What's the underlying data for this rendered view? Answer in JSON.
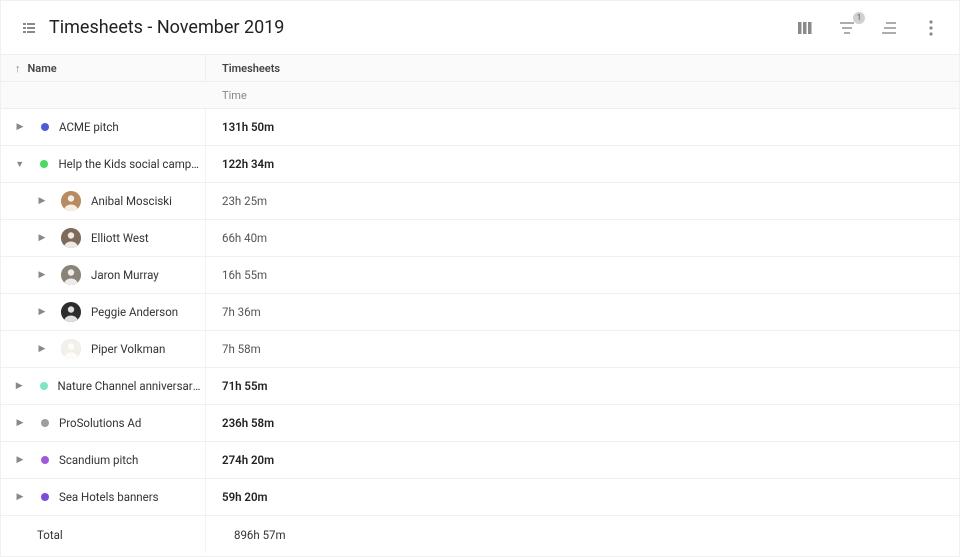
{
  "header": {
    "title": "Timesheets - November 2019",
    "filter_badge": "1"
  },
  "columns": {
    "name": "Name",
    "timesheets": "Timesheets",
    "time": "Time"
  },
  "projects": [
    {
      "name": "ACME pitch",
      "color": "#4f5bd5",
      "time": "131h 50m",
      "expanded": false
    },
    {
      "name": "Help the Kids social campaign",
      "color": "#4cd964",
      "time": "122h 34m",
      "expanded": true,
      "members": [
        {
          "name": "Anibal Mosciski",
          "time": "23h 25m",
          "avatar_bg": "#b78b61"
        },
        {
          "name": "Elliott West",
          "time": "66h 40m",
          "avatar_bg": "#7d6a5a"
        },
        {
          "name": "Jaron Murray",
          "time": "16h 55m",
          "avatar_bg": "#8b8378"
        },
        {
          "name": "Peggie Anderson",
          "time": "7h 36m",
          "avatar_bg": "#2d2d2d"
        },
        {
          "name": "Piper Volkman",
          "time": "7h 58m",
          "avatar_bg": "#f3efe9"
        }
      ]
    },
    {
      "name": "Nature Channel anniversary cam…",
      "color": "#7fe3c6",
      "time": "71h 55m",
      "expanded": false
    },
    {
      "name": "ProSolutions Ad",
      "color": "#9e9e9e",
      "time": "236h 58m",
      "expanded": false
    },
    {
      "name": "Scandium pitch",
      "color": "#a259d9",
      "time": "274h 20m",
      "expanded": false
    },
    {
      "name": "Sea Hotels banners",
      "color": "#7b4fd9",
      "time": "59h 20m",
      "expanded": false
    }
  ],
  "total": {
    "label": "Total",
    "time": "896h 57m"
  }
}
